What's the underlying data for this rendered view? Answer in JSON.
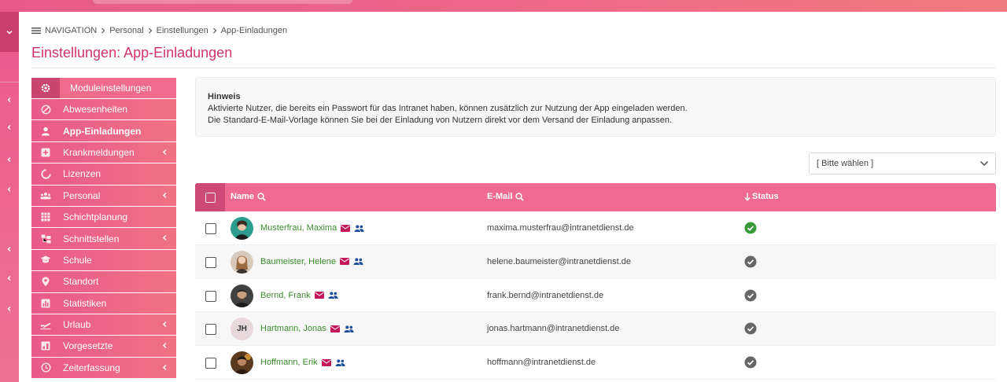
{
  "breadcrumb": {
    "nav_label": "NAVIGATION",
    "items": [
      "Personal",
      "Einstellungen",
      "App-Einladungen"
    ]
  },
  "page": {
    "title": "Einstellungen: App-Einladungen"
  },
  "sidenav": {
    "header": "Moduleinstellungen",
    "items": [
      {
        "label": "Abwesenheiten",
        "icon": "ban-icon",
        "has_submenu": false,
        "active": false
      },
      {
        "label": "App-Einladungen",
        "icon": "user-icon",
        "has_submenu": false,
        "active": true
      },
      {
        "label": "Krankmeldungen",
        "icon": "medical-cross-icon",
        "has_submenu": true,
        "active": false
      },
      {
        "label": "Lizenzen",
        "icon": "circle-notch-icon",
        "has_submenu": false,
        "active": false
      },
      {
        "label": "Personal",
        "icon": "people-group-icon",
        "has_submenu": true,
        "active": false
      },
      {
        "label": "Schichtplanung",
        "icon": "calendar-grid-icon",
        "has_submenu": false,
        "active": false
      },
      {
        "label": "Schnittstellen",
        "icon": "sitemap-icon",
        "has_submenu": true,
        "active": false
      },
      {
        "label": "Schule",
        "icon": "graduation-cap-icon",
        "has_submenu": false,
        "active": false
      },
      {
        "label": "Standort",
        "icon": "map-pin-icon",
        "has_submenu": false,
        "active": false
      },
      {
        "label": "Statistiken",
        "icon": "bar-chart-icon",
        "has_submenu": false,
        "active": false
      },
      {
        "label": "Urlaub",
        "icon": "plane-icon",
        "has_submenu": true,
        "active": false
      },
      {
        "label": "Vorgesetzte",
        "icon": "org-chart-icon",
        "has_submenu": true,
        "active": false
      },
      {
        "label": "Zeiterfassung",
        "icon": "clock-icon",
        "has_submenu": true,
        "active": false
      }
    ]
  },
  "hint": {
    "title": "Hinweis",
    "line1": "Aktivierte Nutzer, die bereits ein Passwort für das Intranet haben, können zusätzlich zur Nutzung der App eingeladen werden.",
    "line2": "Die Standard-E-Mail-Vorlage können Sie bei der Einladung von Nutzern direkt vor dem Versand der Einladung anpassen."
  },
  "filter": {
    "placeholder": "[ Bitte wählen ]"
  },
  "table": {
    "columns": {
      "name": "Name",
      "email": "E-Mail",
      "status": "Status"
    },
    "rows": [
      {
        "name": "Musterfrau, Maxima",
        "email": "maxima.musterfrau@intranetdienst.de",
        "avatar": "photo",
        "initials": "",
        "status": "active"
      },
      {
        "name": "Baumeister, Helene",
        "email": "helene.baumeister@intranetdienst.de",
        "avatar": "photo",
        "initials": "",
        "status": "inactive"
      },
      {
        "name": "Bernd, Frank",
        "email": "frank.bernd@intranetdienst.de",
        "avatar": "photo",
        "initials": "",
        "status": "inactive"
      },
      {
        "name": "Hartmann, Jonas",
        "email": "jonas.hartmann@intranetdienst.de",
        "avatar": "initials",
        "initials": "JH",
        "status": "inactive"
      },
      {
        "name": "Hoffmann, Erik",
        "email": "hoffmann@intranetdienst.de",
        "avatar": "photo",
        "initials": "",
        "status": "inactive"
      }
    ]
  },
  "colors": {
    "brand_pink": "#ef6a91",
    "brand_dark": "#cd4a76",
    "title": "#d2336e",
    "name_green": "#3d8b2f",
    "status_active": "#3a9a3a",
    "status_inactive": "#666666",
    "mail_icon": "#c2185b",
    "group_icon": "#1e4f9c"
  }
}
